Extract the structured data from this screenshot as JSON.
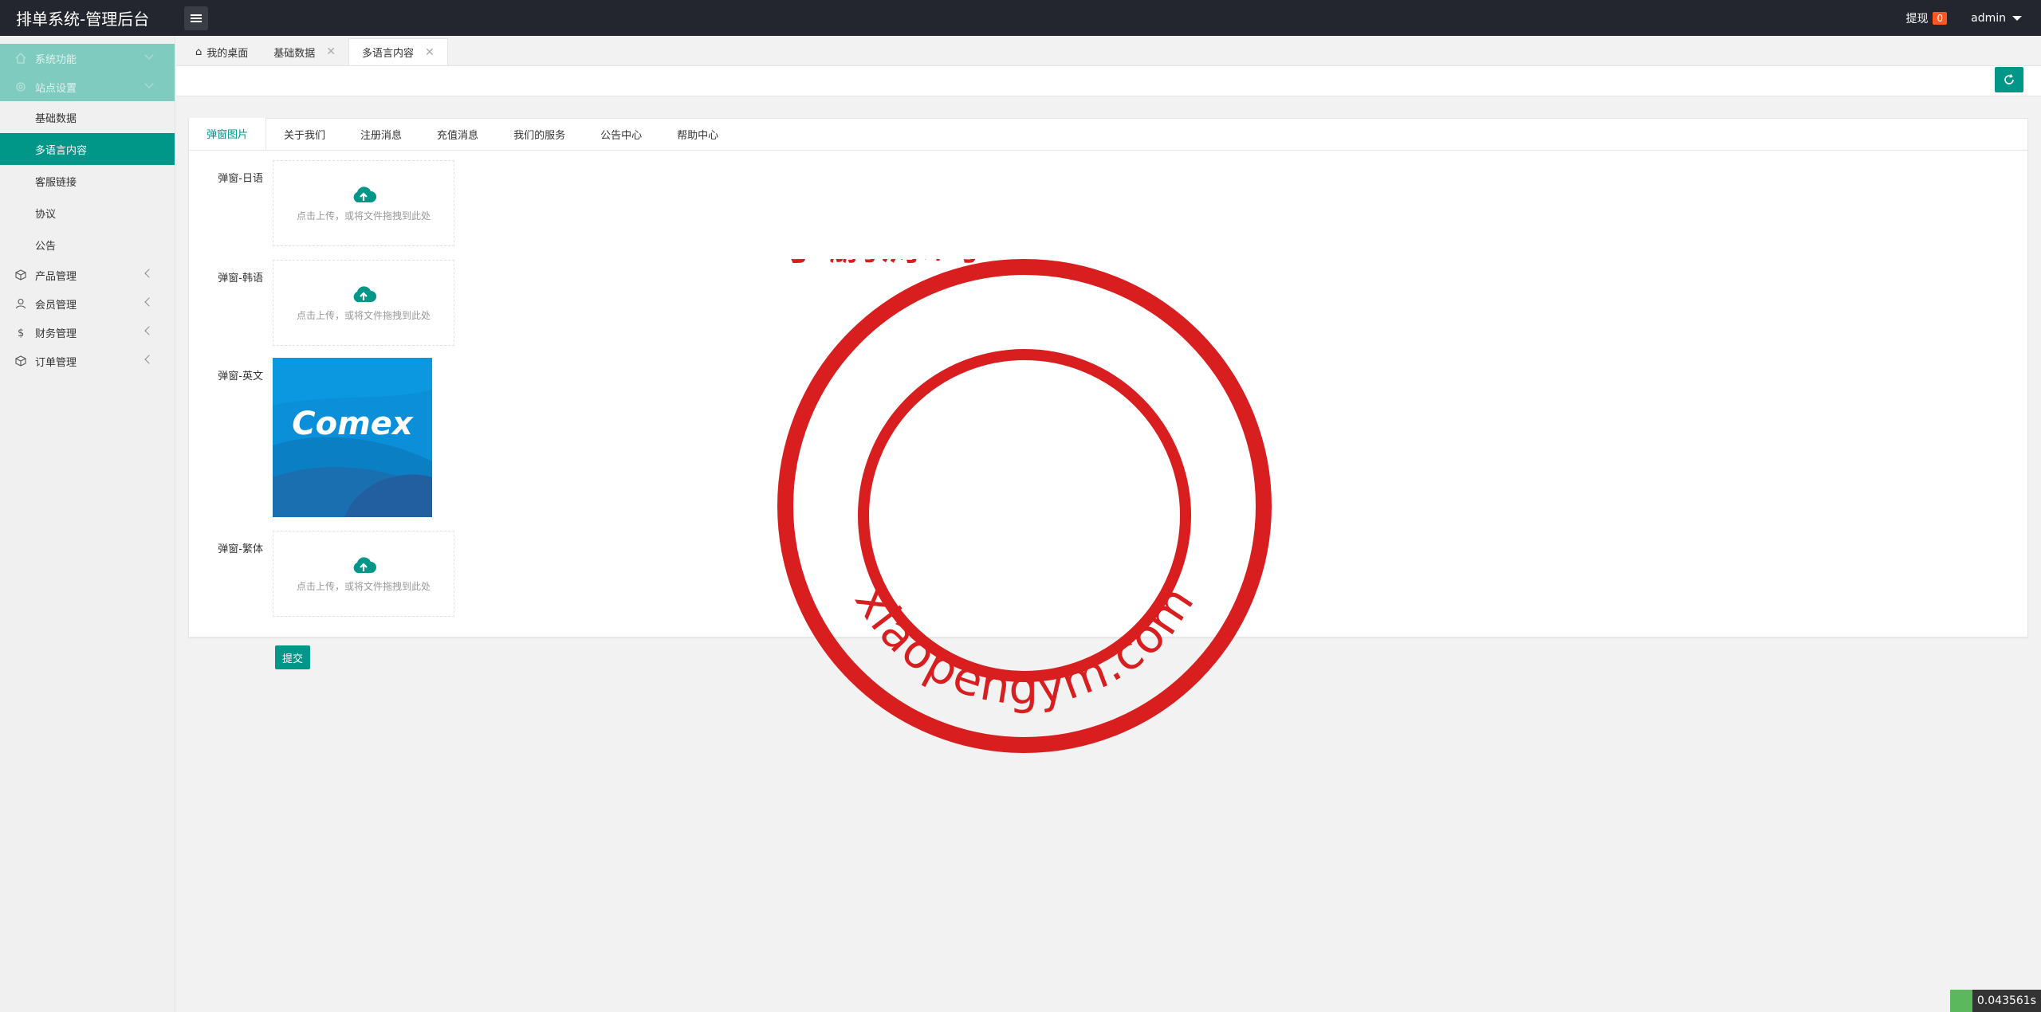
{
  "app": {
    "title": "排单系统-管理后台"
  },
  "header": {
    "withdraw_label": "提现",
    "withdraw_count": "0",
    "user": "admin"
  },
  "sidebar": {
    "groups_top": [
      {
        "label": "系统功能",
        "icon": "home-icon"
      },
      {
        "label": "站点设置",
        "icon": "gear-icon"
      }
    ],
    "sub_items": [
      {
        "label": "基础数据",
        "active": false
      },
      {
        "label": "多语言内容",
        "active": true
      },
      {
        "label": "客服链接",
        "active": false
      },
      {
        "label": "协议",
        "active": false
      },
      {
        "label": "公告",
        "active": false
      }
    ],
    "groups_bottom": [
      {
        "label": "产品管理",
        "icon": "cube-icon"
      },
      {
        "label": "会员管理",
        "icon": "user-icon"
      },
      {
        "label": "财务管理",
        "icon": "dollar-icon"
      },
      {
        "label": "订单管理",
        "icon": "box-icon"
      }
    ]
  },
  "tabs": [
    {
      "label": "我的桌面",
      "closable": false
    },
    {
      "label": "基础数据",
      "closable": true
    },
    {
      "label": "多语言内容",
      "closable": true,
      "active": true
    }
  ],
  "content_tabs": [
    "弹窗图片",
    "关于我们",
    "注册消息",
    "充值消息",
    "我们的服务",
    "公告中心",
    "帮助中心"
  ],
  "form": {
    "fields": [
      {
        "label": "弹窗-日语",
        "type": "upload",
        "hint": "点击上传，或将文件拖拽到此处"
      },
      {
        "label": "弹窗-韩语",
        "type": "upload",
        "hint": "点击上传，或将文件拖拽到此处"
      },
      {
        "label": "弹窗-英文",
        "type": "image",
        "brand": "Comex"
      },
      {
        "label": "弹窗-繁体",
        "type": "upload",
        "hint": "点击上传，或将文件拖拽到此处"
      }
    ],
    "submit_label": "提交"
  },
  "watermark": {
    "top_text": "小鹏源码",
    "bottom_text": "xiaopengym.com",
    "color": "#d81e1e"
  },
  "footer": {
    "timer": "0.043561s"
  },
  "colors": {
    "accent": "#009688",
    "topbar": "#23262e",
    "badge": "#ff5722"
  }
}
